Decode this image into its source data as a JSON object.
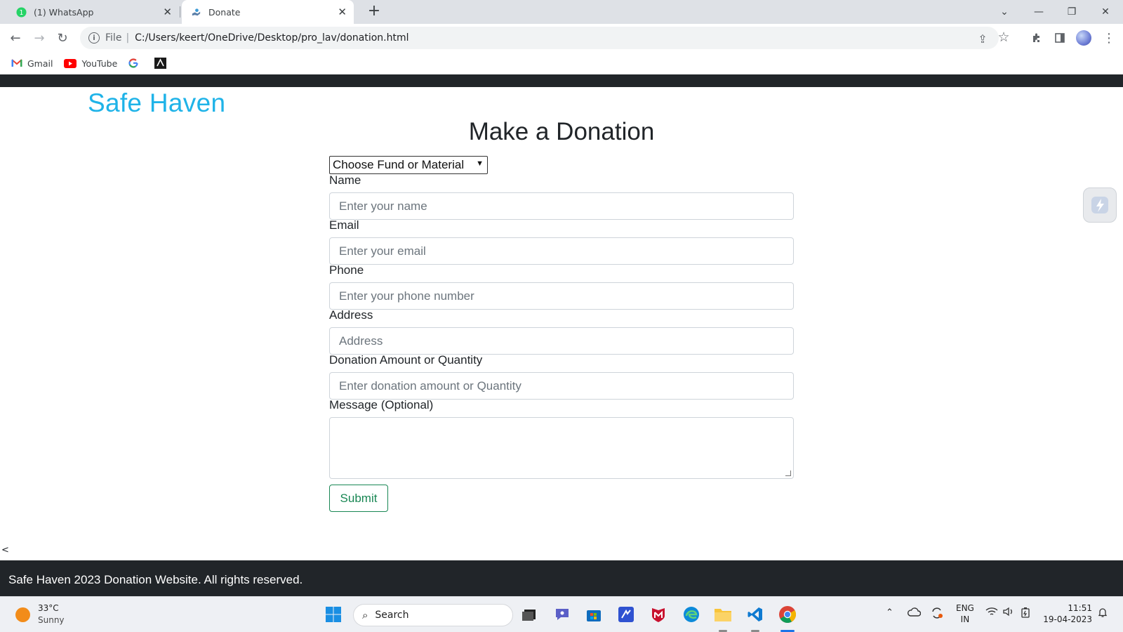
{
  "browser": {
    "tabs": [
      {
        "label": "(1) WhatsApp",
        "icon": "whatsapp-icon",
        "active": false
      },
      {
        "label": "Donate",
        "icon": "page-favicon-icon",
        "active": true
      }
    ],
    "address": {
      "scheme": "File",
      "url": "C:/Users/keert/OneDrive/Desktop/pro_lav/donation.html"
    },
    "bookmarks": [
      {
        "label": "Gmail",
        "icon": "gmail-icon"
      },
      {
        "label": "YouTube",
        "icon": "youtube-icon"
      },
      {
        "label": "",
        "icon": "google-icon"
      },
      {
        "label": "",
        "icon": "bookmark-app-icon"
      }
    ]
  },
  "page": {
    "logo": "Safe Haven",
    "heading": "Make a Donation",
    "select": {
      "value": "Choose Fund or Material"
    },
    "fields": {
      "name": {
        "label": "Name",
        "placeholder": "Enter your name"
      },
      "email": {
        "label": "Email",
        "placeholder": "Enter your email"
      },
      "phone": {
        "label": "Phone",
        "placeholder": "Enter your phone number"
      },
      "address": {
        "label": "Address",
        "placeholder": "Address"
      },
      "amount": {
        "label": "Donation Amount or Quantity",
        "placeholder": "Enter donation amount or Quantity"
      },
      "message": {
        "label": "Message (Optional)",
        "value": ""
      }
    },
    "submit_label": "Submit",
    "stray_text": "<",
    "footer": "Safe Haven 2023 Donation Website. All rights reserved."
  },
  "taskbar": {
    "weather": {
      "temp": "33°C",
      "condition": "Sunny"
    },
    "search_label": "Search",
    "language": {
      "line1": "ENG",
      "line2": "IN"
    },
    "clock": {
      "time": "11:51",
      "date": "19-04-2023"
    }
  },
  "colors": {
    "brand": "#1fb3e8",
    "dark_bar": "#212529",
    "submit": "#198754"
  }
}
